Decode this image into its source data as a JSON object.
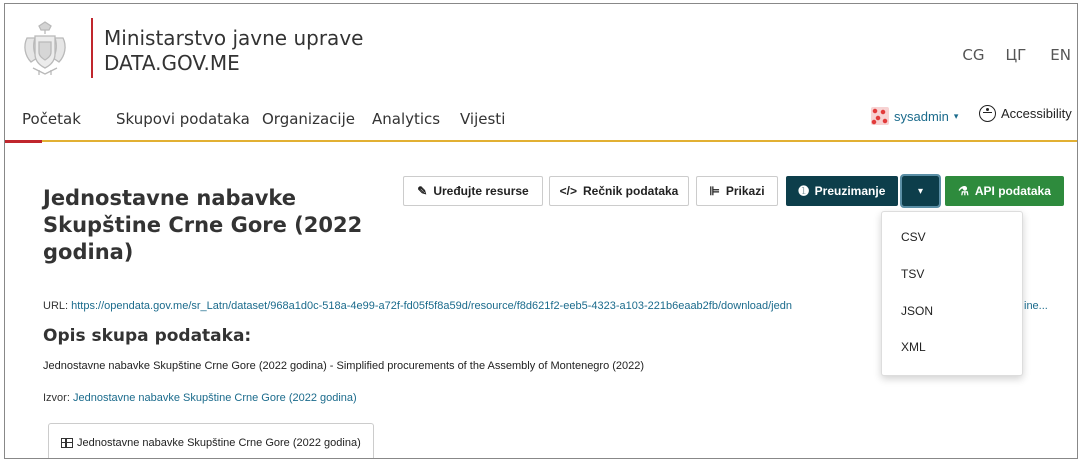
{
  "header": {
    "site_name_line1": "Ministarstvo javne uprave",
    "site_name_line2": "DATA.GOV.ME",
    "languages": [
      "CG",
      "ЦГ",
      "EN"
    ]
  },
  "nav": {
    "items": [
      "Početak",
      "Skupovi podataka",
      "Organizacije",
      "Analytics",
      "Vijesti"
    ],
    "user": "sysadmin",
    "accessibility": "Accessibility"
  },
  "resource": {
    "title": "Jednostavne nabavke Skupštine Crne Gore (2022 godina)",
    "buttons": {
      "edit": "Uređujte resurse",
      "dictionary": "Rečnik podataka",
      "views": "Prikazi",
      "download": "Preuzimanje",
      "api": "API podataka"
    },
    "download_formats": [
      "CSV",
      "TSV",
      "JSON",
      "XML"
    ],
    "url_label": "URL:",
    "url": "https://opendata.gov.me/sr_Latn/dataset/968a1d0c-518a-4e99-a72f-fd05f5f8a59d/resource/f8d621f2-eeb5-4323-a103-221b6eaab2fb/download/jedn",
    "url_tail": "ine...",
    "description_heading": "Opis skupa podataka:",
    "description": "Jednostavne nabavke Skupštine Crne Gore (2022 godina) - Simplified procurements of the Assembly of Montenegro (2022)",
    "source_label": "Izvor:",
    "source_link": "Jednostavne nabavke Skupštine Crne Gore (2022 godina)",
    "tab_label": "Jednostavne nabavke Skupštine Crne Gore (2022 godina)"
  },
  "colors": {
    "brand_red": "#c0262d",
    "brand_gold": "#e2b033",
    "download_dark": "#0d3e4b",
    "api_green": "#2e8b3d",
    "link": "#1b6b8c"
  }
}
